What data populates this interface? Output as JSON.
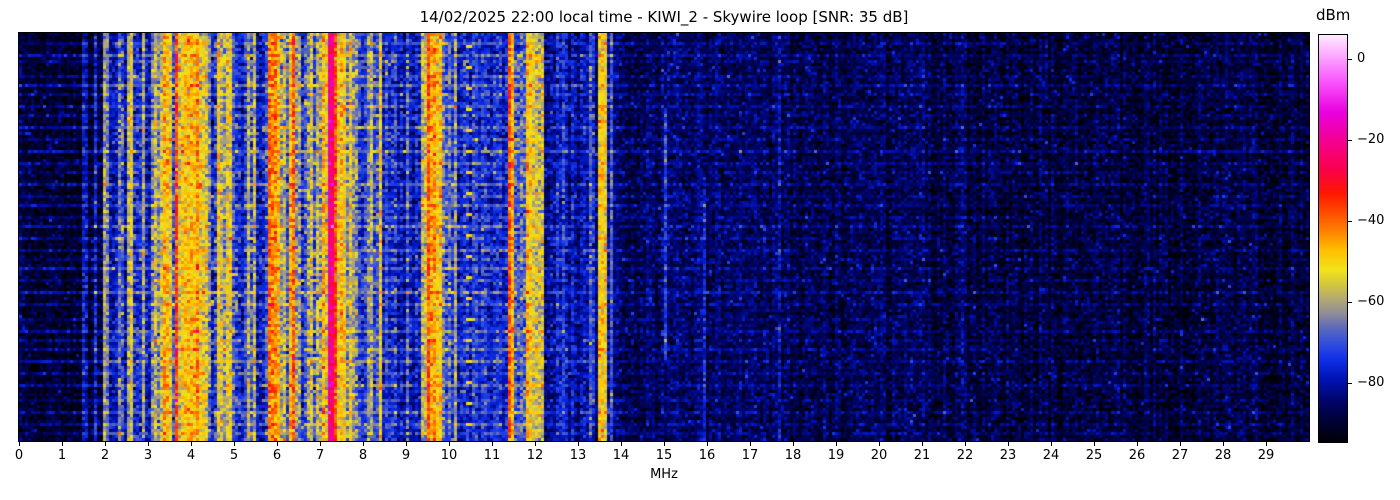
{
  "chart_data": {
    "type": "heatmap",
    "title": "14/02/2025 22:00 local time - KIWI_2 - Skywire loop [SNR: 35 dB]",
    "xlabel": "MHz",
    "x_range": [
      0,
      30
    ],
    "x_ticks": [
      "0",
      "1",
      "2",
      "3",
      "4",
      "5",
      "6",
      "7",
      "8",
      "9",
      "10",
      "11",
      "12",
      "13",
      "14",
      "15",
      "16",
      "17",
      "18",
      "19",
      "20",
      "21",
      "22",
      "23",
      "24",
      "25",
      "26",
      "27",
      "28",
      "29"
    ],
    "y_axis_ticks": [],
    "grid": false,
    "colorbar": {
      "label": "dBm",
      "tick_labels": [
        "0",
        "−20",
        "−40",
        "−60",
        "−80"
      ],
      "tick_values": [
        0,
        -20,
        -40,
        -60,
        -80
      ],
      "value_top": 6,
      "value_bottom": -94.5,
      "position": "right"
    },
    "colormap_stops": [
      [
        -95,
        "#000000"
      ],
      [
        -89,
        "#000238"
      ],
      [
        -84,
        "#00056e"
      ],
      [
        -79,
        "#0013b4"
      ],
      [
        -74,
        "#1030e8"
      ],
      [
        -70,
        "#3350dd"
      ],
      [
        -66,
        "#5f6bbb"
      ],
      [
        -63,
        "#8c8a9a"
      ],
      [
        -60,
        "#aaa37e"
      ],
      [
        -56,
        "#cfc345"
      ],
      [
        -52,
        "#f2e41c"
      ],
      [
        -47,
        "#ffc000"
      ],
      [
        -43,
        "#ff8a00"
      ],
      [
        -38,
        "#ff5000"
      ],
      [
        -33,
        "#ff1800"
      ],
      [
        -27,
        "#fc004e"
      ],
      [
        -20,
        "#f40092"
      ],
      [
        -13,
        "#ea00e0"
      ],
      [
        -5,
        "#f95bff"
      ],
      [
        6,
        "#ffeaff"
      ]
    ],
    "bands_format": "[f0_MHz, f1_MHz, level_dBm, stripe_variation_dB, (optional) rowFracStart, rowFracEnd]",
    "bands": [
      [
        0.0,
        0.35,
        -89,
        3
      ],
      [
        0.35,
        1.5,
        -91,
        2
      ],
      [
        1.5,
        1.58,
        -80,
        3
      ],
      [
        1.58,
        1.75,
        -91,
        2
      ],
      [
        1.75,
        1.84,
        -80,
        4
      ],
      [
        1.84,
        1.92,
        -88,
        3
      ],
      [
        1.92,
        2.0,
        -62,
        6
      ],
      [
        2.0,
        2.06,
        -67,
        5
      ],
      [
        2.06,
        2.28,
        -79,
        4
      ],
      [
        2.28,
        2.42,
        -70,
        8
      ],
      [
        2.42,
        2.52,
        -80,
        4
      ],
      [
        2.52,
        2.64,
        -56,
        6
      ],
      [
        2.64,
        2.86,
        -74,
        7
      ],
      [
        2.86,
        2.96,
        -60,
        6
      ],
      [
        2.96,
        3.08,
        -76,
        5
      ],
      [
        3.08,
        3.34,
        -58,
        7
      ],
      [
        3.34,
        3.56,
        -50,
        6
      ],
      [
        3.56,
        3.64,
        -70,
        8
      ],
      [
        3.64,
        3.72,
        -38,
        5
      ],
      [
        3.72,
        3.8,
        -52,
        6
      ],
      [
        3.8,
        4.0,
        -54,
        5
      ],
      [
        4.0,
        4.1,
        -48,
        5
      ],
      [
        4.1,
        4.22,
        -40,
        5
      ],
      [
        4.22,
        4.4,
        -54,
        6
      ],
      [
        4.4,
        4.62,
        -72,
        9
      ],
      [
        4.62,
        4.78,
        -61,
        8
      ],
      [
        4.78,
        4.92,
        -56,
        6
      ],
      [
        4.92,
        5.3,
        -74,
        6
      ],
      [
        5.3,
        5.52,
        -64,
        8
      ],
      [
        5.52,
        5.82,
        -74,
        6
      ],
      [
        5.82,
        5.98,
        -48,
        7
      ],
      [
        5.98,
        6.18,
        -55,
        7
      ],
      [
        6.18,
        6.28,
        -68,
        7
      ],
      [
        6.28,
        6.44,
        -46,
        6
      ],
      [
        6.44,
        6.7,
        -70,
        8
      ],
      [
        6.7,
        6.82,
        -58,
        8
      ],
      [
        6.82,
        7.02,
        -64,
        9
      ],
      [
        7.02,
        7.16,
        -50,
        6
      ],
      [
        7.16,
        7.22,
        -33,
        4
      ],
      [
        7.22,
        7.36,
        -22,
        3
      ],
      [
        7.36,
        7.42,
        -35,
        4
      ],
      [
        7.42,
        7.58,
        -52,
        6
      ],
      [
        7.58,
        7.72,
        -60,
        7
      ],
      [
        7.72,
        7.92,
        -66,
        8
      ],
      [
        7.92,
        8.1,
        -74,
        6
      ],
      [
        8.1,
        8.22,
        -62,
        7
      ],
      [
        8.22,
        8.38,
        -74,
        6
      ],
      [
        8.38,
        8.46,
        -58,
        7
      ],
      [
        8.46,
        8.7,
        -76,
        5
      ],
      [
        8.7,
        8.78,
        -68,
        7
      ],
      [
        8.78,
        9.02,
        -77,
        5
      ],
      [
        9.02,
        9.1,
        -66,
        7
      ],
      [
        9.1,
        9.36,
        -77,
        5
      ],
      [
        9.36,
        9.46,
        -56,
        6
      ],
      [
        9.46,
        9.54,
        -42,
        5
      ],
      [
        9.54,
        9.86,
        -52,
        6
      ],
      [
        9.86,
        10.1,
        -72,
        6
      ],
      [
        10.1,
        10.18,
        -66,
        6
      ],
      [
        10.18,
        10.4,
        -76,
        5
      ],
      [
        10.4,
        10.47,
        -78,
        4
      ],
      [
        10.47,
        11.4,
        -77,
        5
      ],
      [
        11.4,
        11.52,
        -44,
        6
      ],
      [
        11.52,
        11.8,
        -72,
        7
      ],
      [
        11.8,
        12.08,
        -54,
        6
      ],
      [
        12.08,
        12.24,
        -64,
        8
      ],
      [
        12.24,
        12.6,
        -80,
        5
      ],
      [
        12.6,
        12.68,
        -75,
        5
      ],
      [
        12.68,
        13.28,
        -81,
        4
      ],
      [
        13.28,
        13.38,
        -73,
        5
      ],
      [
        13.38,
        13.5,
        -82,
        4
      ],
      [
        13.5,
        13.64,
        -54,
        5
      ],
      [
        13.64,
        13.72,
        -80,
        4
      ],
      [
        13.72,
        13.82,
        -67,
        5
      ],
      [
        13.82,
        14.97,
        -86,
        3
      ],
      [
        14.97,
        15.05,
        -72,
        3,
        0.18,
        0.8
      ],
      [
        15.05,
        15.9,
        -86,
        3
      ],
      [
        15.9,
        15.98,
        -78,
        3,
        0.35,
        1.0
      ],
      [
        15.98,
        17.62,
        -87,
        3
      ],
      [
        17.62,
        17.72,
        -76,
        4
      ],
      [
        17.72,
        20.9,
        -88,
        3
      ],
      [
        20.9,
        21.05,
        -84,
        3
      ],
      [
        21.05,
        21.9,
        -88,
        3
      ],
      [
        21.9,
        22.05,
        -83,
        3
      ],
      [
        22.05,
        30.01,
        -89,
        3
      ]
    ],
    "dot_columns": [
      {
        "f0": 10.4,
        "f1": 10.47,
        "level": -50,
        "period": 7,
        "offset": 3
      }
    ],
    "streak_rows": [
      [
        0.02,
        6
      ],
      [
        0.05,
        9
      ],
      [
        0.07,
        5
      ],
      [
        0.1,
        7
      ],
      [
        0.125,
        10
      ],
      [
        0.15,
        6
      ],
      [
        0.175,
        8
      ],
      [
        0.2,
        5
      ],
      [
        0.23,
        9
      ],
      [
        0.26,
        6
      ],
      [
        0.29,
        11
      ],
      [
        0.315,
        7
      ],
      [
        0.34,
        5
      ],
      [
        0.37,
        9
      ],
      [
        0.4,
        6
      ],
      [
        0.425,
        8
      ],
      [
        0.45,
        5
      ],
      [
        0.475,
        10
      ],
      [
        0.5,
        6
      ],
      [
        0.53,
        8
      ],
      [
        0.555,
        5
      ],
      [
        0.58,
        9
      ],
      [
        0.61,
        6
      ],
      [
        0.64,
        11
      ],
      [
        0.67,
        7
      ],
      [
        0.7,
        5
      ],
      [
        0.73,
        9
      ],
      [
        0.755,
        6
      ],
      [
        0.78,
        8
      ],
      [
        0.81,
        10
      ],
      [
        0.84,
        6
      ],
      [
        0.87,
        8
      ],
      [
        0.9,
        5
      ],
      [
        0.93,
        9
      ],
      [
        0.96,
        7
      ],
      [
        0.985,
        6
      ]
    ],
    "noise": {
      "sigma": 2.4,
      "spike_chance": 0.05,
      "spike_db": 8
    }
  }
}
